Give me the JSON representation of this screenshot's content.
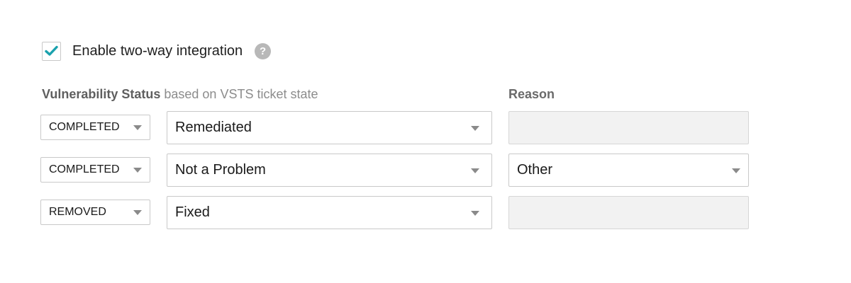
{
  "integration": {
    "checkbox_checked": true,
    "label": "Enable two-way integration",
    "help_icon": "question-circle-icon"
  },
  "headers": {
    "status_strong": "Vulnerability Status",
    "status_light": " based on VSTS ticket state",
    "reason": "Reason"
  },
  "colors": {
    "check_mark": "#1aa1ad",
    "help_icon_bg": "#b8b8b8",
    "disabled_bg": "#f2f2f2"
  },
  "rows": [
    {
      "state": "COMPLETED",
      "status": "Remediated",
      "reason": "",
      "reason_enabled": false
    },
    {
      "state": "COMPLETED",
      "status": "Not a Problem",
      "reason": "Other",
      "reason_enabled": true
    },
    {
      "state": "REMOVED",
      "status": "Fixed",
      "reason": "",
      "reason_enabled": false
    }
  ]
}
